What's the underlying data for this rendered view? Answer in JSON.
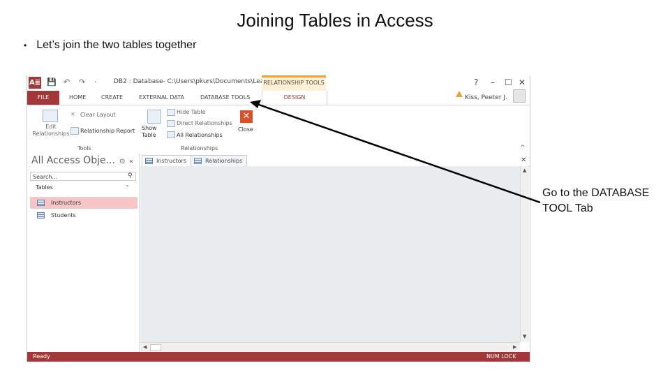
{
  "slide": {
    "title": "Joining Tables in Access",
    "bullet": "Let’s join the two tables together",
    "bullet_marker": "•",
    "callout": "Go to the DATABASE TOOL Tab"
  },
  "window": {
    "app_icon": "A≣",
    "doc_title": "DB2 : Database- C:\\Users\\pkurs\\Documents\\Lea...",
    "context_header": "RELATIONSHIP TOOLS",
    "controls": [
      "?",
      "–",
      "☐",
      "✕"
    ],
    "user": "Kiss, Peeter J.",
    "quick_access": [
      "💾",
      "↶",
      "↷",
      "⋅"
    ]
  },
  "ribbon_tabs": {
    "file": "FILE",
    "home": "HOME",
    "create": "CREATE",
    "external_data": "EXTERNAL DATA",
    "database_tools": "DATABASE TOOLS",
    "design": "DESIGN"
  },
  "ribbon": {
    "edit_relationships": "Edit Relationships",
    "clear_layout": "Clear Layout",
    "relationship_report": "Relationship Report",
    "tools_group": "Tools",
    "show_table": "Show Table",
    "hide_table": "Hide Table",
    "direct_relationships": "Direct Relationships",
    "all_relationships": "All Relationships",
    "close": "Close",
    "relationships_group": "Relationships",
    "collapse": "^"
  },
  "nav_pane": {
    "header": "All Access Obje...",
    "search_placeholder": "Search...",
    "section": "Tables",
    "items": [
      {
        "label": "Instructors",
        "selected": true
      },
      {
        "label": "Students",
        "selected": false
      }
    ]
  },
  "doc_tabs": [
    {
      "label": "Instructors"
    },
    {
      "label": "Relationships"
    }
  ],
  "status": {
    "left": "Ready",
    "right": "NUM LOCK"
  },
  "colors": {
    "access_red": "#a4373a",
    "context_orange": "#e8a33b",
    "workspace": "#e8ecef"
  }
}
